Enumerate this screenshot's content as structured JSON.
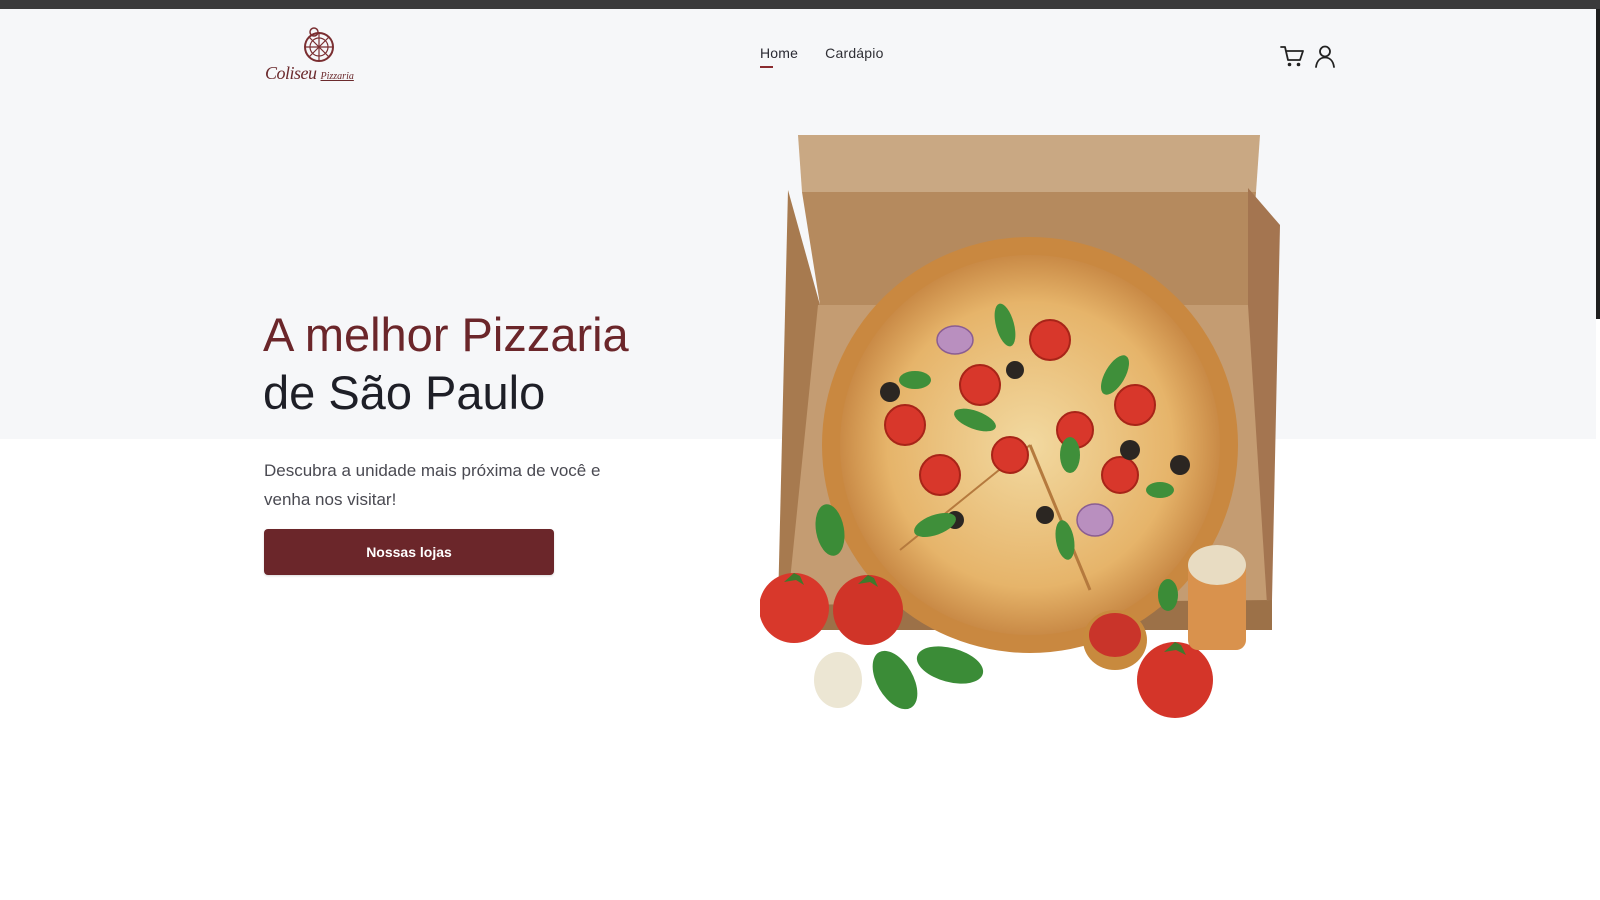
{
  "logo": {
    "brand": "Coliseu",
    "sub": "Pizzaria"
  },
  "nav": {
    "items": [
      {
        "label": "Home",
        "active": true
      },
      {
        "label": "Cardápio",
        "active": false
      }
    ]
  },
  "header_icons": [
    "cart-icon",
    "user-icon"
  ],
  "hero": {
    "headline_line1": "A melhor Pizzaria",
    "headline_line2": "de São Paulo",
    "subtitle": "Descubra a unidade mais próxima de você e venha nos visitar!",
    "cta_label": "Nossas lojas",
    "image": "pizza-in-box-image"
  },
  "colors": {
    "brand": "#6b262a",
    "nav_active_underline": "#8a2b2f",
    "hero_background": "#f6f7f9",
    "text_dark": "#1e1f27"
  }
}
